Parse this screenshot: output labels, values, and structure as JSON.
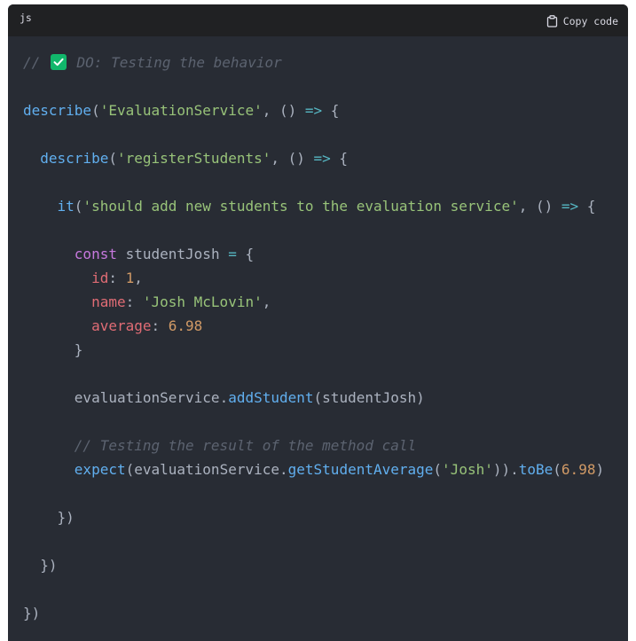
{
  "header": {
    "language": "js",
    "copy_label": "Copy code"
  },
  "code": {
    "comment_prefix": "// ",
    "comment_text": " DO: Testing the behavior",
    "describe_fn": "describe",
    "describe_name": "'EvaluationService'",
    "inner_describe_name": "'registerStudents'",
    "arrow_open": "() => {",
    "it_fn": "it",
    "it_name": "'should add new students to the evaluation service'",
    "const_kw": "const",
    "var_name": "studentJosh",
    "id_key": "id",
    "id_val": "1",
    "name_key": "name",
    "name_val": "'Josh McLovin'",
    "avg_key": "average",
    "avg_val": "6.98",
    "service_obj": "evaluationService",
    "add_method": "addStudent",
    "arg": "studentJosh",
    "comment2": "// Testing the result of the method call",
    "expect_fn": "expect",
    "get_method": "getStudentAverage",
    "get_arg": "'Josh'",
    "tobe_method": "toBe",
    "tobe_val": "6.98"
  },
  "colors": {
    "background": "#282c34",
    "header_bg": "#202123",
    "check_badge": "#11b76b",
    "function": "#61afef",
    "string": "#98c379",
    "keyword": "#c678dd",
    "property": "#e06c75",
    "number": "#d19a66",
    "operator": "#56b6c2",
    "comment": "#5c6370"
  }
}
